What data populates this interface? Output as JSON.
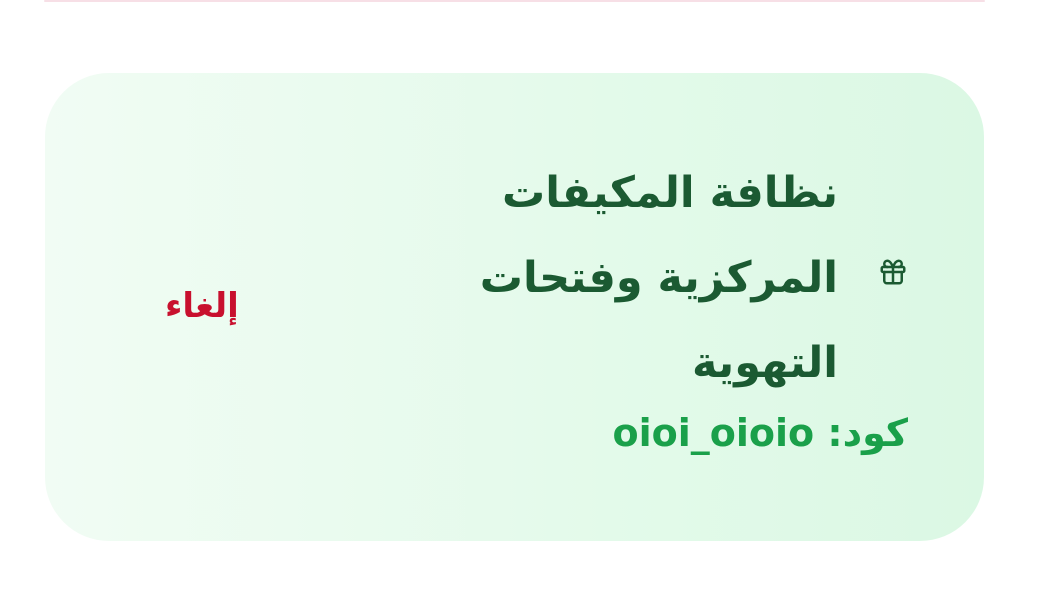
{
  "coupon": {
    "service_title": "نظافة المكيفات المركزية وفتحات التهوية",
    "code_label": "كود:",
    "code_value": "oioi_oioio",
    "cancel_label": "إلغاء",
    "icon": "gift-icon"
  },
  "colors": {
    "title": "#1b5a32",
    "code": "#1aa04a",
    "cancel": "#c8102e",
    "card_bg_start": "#f1fcf4",
    "card_bg_end": "#dbf8e4",
    "divider": "#f7dfe6"
  }
}
